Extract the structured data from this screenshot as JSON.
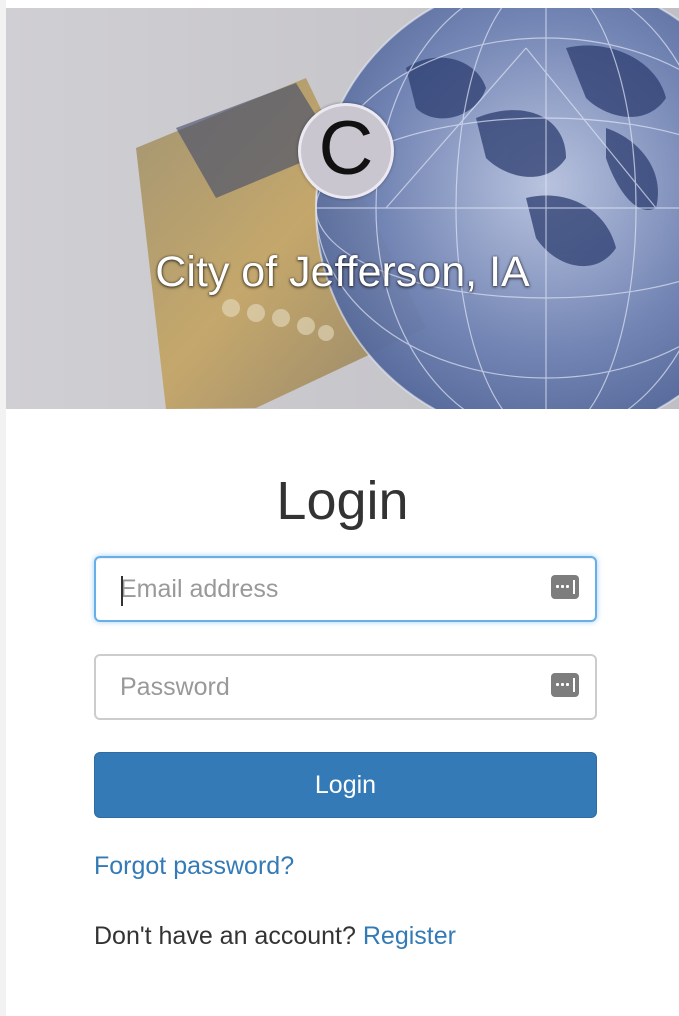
{
  "header": {
    "logo_letter": "C",
    "org_name": "City of Jefferson, IA"
  },
  "form": {
    "title": "Login",
    "email": {
      "value": "",
      "placeholder": "Email address"
    },
    "password": {
      "value": "",
      "placeholder": "Password"
    },
    "submit_label": "Login",
    "forgot_label": "Forgot password?",
    "register_prompt": "Don't have an account?",
    "register_label": "Register"
  },
  "icons": {
    "field_icon": "password-manager-icon"
  },
  "colors": {
    "primary": "#337ab7",
    "focus": "#66afe9",
    "title": "#333333"
  }
}
